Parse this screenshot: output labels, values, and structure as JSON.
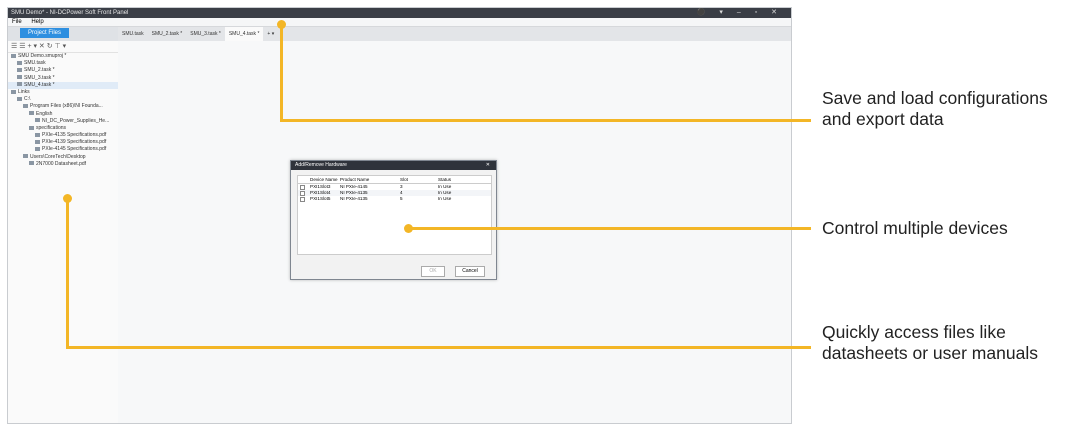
{
  "window": {
    "title": "SMU Demo* - NI-DCPower Soft Front Panel",
    "controls": "⚫ ▾ – ▫ ✕"
  },
  "menu": [
    "File",
    "Help"
  ],
  "left_panel": {
    "tab": "Project Files",
    "toolbar": "☰ ☰ + ▾ ✕   ↻ ⊤ ▾",
    "tree": [
      {
        "label": "SMU Demo.smuproj *",
        "indent": 0,
        "sel": false
      },
      {
        "label": "SMU.task",
        "indent": 1,
        "sel": false
      },
      {
        "label": "SMU_2.task *",
        "indent": 1,
        "sel": false
      },
      {
        "label": "SMU_3.task *",
        "indent": 1,
        "sel": false
      },
      {
        "label": "SMU_4.task *",
        "indent": 1,
        "sel": true
      },
      {
        "label": "Links",
        "indent": 0,
        "sel": false
      },
      {
        "label": "C:\\",
        "indent": 1,
        "sel": false
      },
      {
        "label": "Program Files (x86)\\NI Founda...",
        "indent": 2,
        "sel": false
      },
      {
        "label": "English",
        "indent": 3,
        "sel": false
      },
      {
        "label": "NI_DC_Power_Supplies_He...",
        "indent": 4,
        "sel": false
      },
      {
        "label": "specifications",
        "indent": 3,
        "sel": false
      },
      {
        "label": "PXIe-4135 Specifications.pdf",
        "indent": 4,
        "sel": false
      },
      {
        "label": "PXIe-4139 Specifications.pdf",
        "indent": 4,
        "sel": false
      },
      {
        "label": "PXIe-4145 Specifications.pdf",
        "indent": 4,
        "sel": false
      },
      {
        "label": "Users\\CoreTech\\Desktop",
        "indent": 2,
        "sel": false
      },
      {
        "label": "2N7000 Datasheet.pdf",
        "indent": 3,
        "sel": false
      }
    ]
  },
  "doc_tabs": [
    "SMU.task",
    "SMU_2.task *",
    "SMU_3.task *",
    "SMU_4.task *",
    "+ ▾"
  ],
  "dialog": {
    "title": "Add/Remove Hardware",
    "close": "✕",
    "headers": [
      "Device Name",
      "Product Name",
      "Slot",
      "Status"
    ],
    "rows": [
      [
        "PXI1Slot3",
        "NI PXIe-4145",
        "3",
        "In Use"
      ],
      [
        "PXI1Slot4",
        "NI PXIe-4135",
        "4",
        "In Use"
      ],
      [
        "PXI1Slot5",
        "NI PXIe-4135",
        "5",
        "In Use"
      ]
    ],
    "ok": "OK",
    "cancel": "Cancel"
  },
  "callouts": [
    "Save and load configurations and export data",
    "Control multiple devices",
    "Quickly access files like datasheets or user manuals"
  ],
  "colors": {
    "accent": "#f3b626",
    "tab_blue": "#2e8fe0"
  }
}
